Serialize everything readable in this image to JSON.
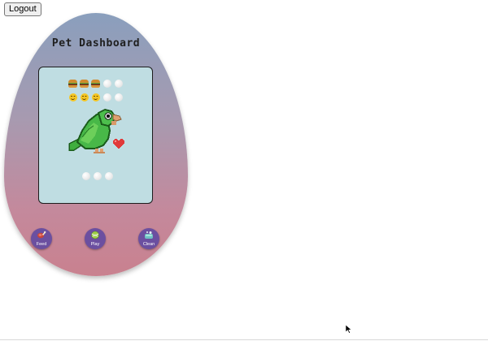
{
  "header": {
    "logout_label": "Logout"
  },
  "device": {
    "title": "Pet Dashboard",
    "shell_gradient": [
      "#8a9fbd",
      "#c9818f"
    ],
    "screen_color": "#bfdde2"
  },
  "stats": {
    "hunger": {
      "filled": 3,
      "max": 5,
      "icon": "burger-icon"
    },
    "happiness": {
      "filled": 3,
      "max": 5,
      "icon": "smiley-icon"
    },
    "cleanliness": {
      "filled": 0,
      "max": 3,
      "icon": "bubble-icon"
    }
  },
  "pet": {
    "sprite": "green-parrot",
    "mood_icon": "heart-icon",
    "body_color": "#3fae3f",
    "heart_color": "#e03a3a"
  },
  "actions": [
    {
      "label": "Feed",
      "icon": "meat-icon"
    },
    {
      "label": "Play",
      "icon": "ball-icon"
    },
    {
      "label": "Clean",
      "icon": "soap-icon"
    }
  ],
  "colors": {
    "button": "#6b4fa0"
  }
}
